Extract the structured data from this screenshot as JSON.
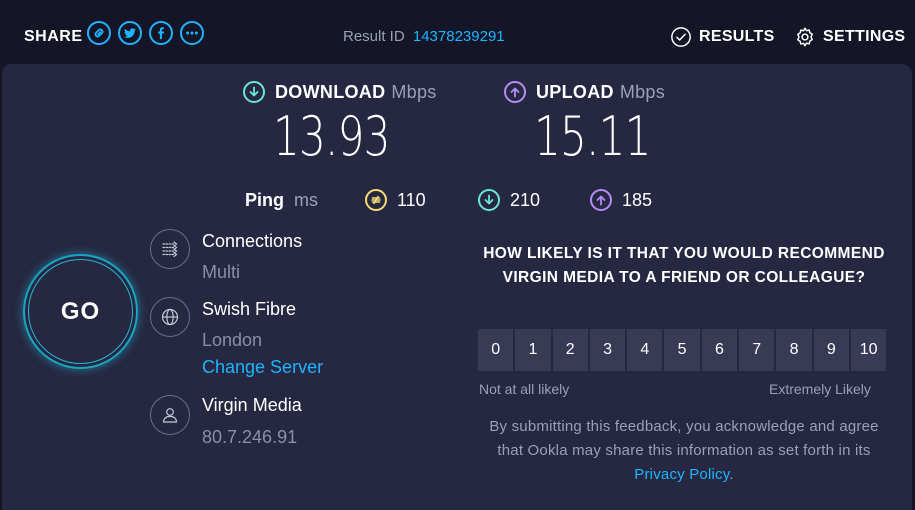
{
  "header": {
    "share_label": "SHARE",
    "share_icons": [
      "link-icon",
      "twitter-icon",
      "facebook-icon",
      "more-icon"
    ],
    "result_id_label": "Result ID",
    "result_id_value": "14378239291",
    "results_label": "RESULTS",
    "settings_label": "SETTINGS"
  },
  "download": {
    "label": "DOWNLOAD",
    "unit": "Mbps",
    "value": "13.93"
  },
  "upload": {
    "label": "UPLOAD",
    "unit": "Mbps",
    "value": "15.11"
  },
  "ping": {
    "label": "Ping",
    "unit": "ms",
    "idle": "110",
    "download": "210",
    "upload": "185"
  },
  "go_label": "GO",
  "connections": {
    "title": "Connections",
    "value": "Multi"
  },
  "server": {
    "name": "Swish Fibre",
    "location": "London",
    "change_label": "Change Server"
  },
  "isp": {
    "name": "Virgin Media",
    "ip": "80.7.246.91"
  },
  "survey": {
    "question": "HOW LIKELY IS IT THAT YOU WOULD RECOMMEND VIRGIN MEDIA TO A FRIEND OR COLLEAGUE?",
    "scale": [
      "0",
      "1",
      "2",
      "3",
      "4",
      "5",
      "6",
      "7",
      "8",
      "9",
      "10"
    ],
    "low_label": "Not at all likely",
    "high_label": "Extremely Likely",
    "disclaimer_pre": "By submitting this feedback, you acknowledge and agree that Ookla may share this information as set forth in its",
    "privacy_link": "Privacy Policy",
    "disclaimer_post": "."
  },
  "colors": {
    "background": "#141526",
    "card": "#262741",
    "accent_blue": "#1fb4ff",
    "download": "#6ae6d5",
    "upload": "#b58cf6",
    "ping_idle": "#f4de74"
  }
}
